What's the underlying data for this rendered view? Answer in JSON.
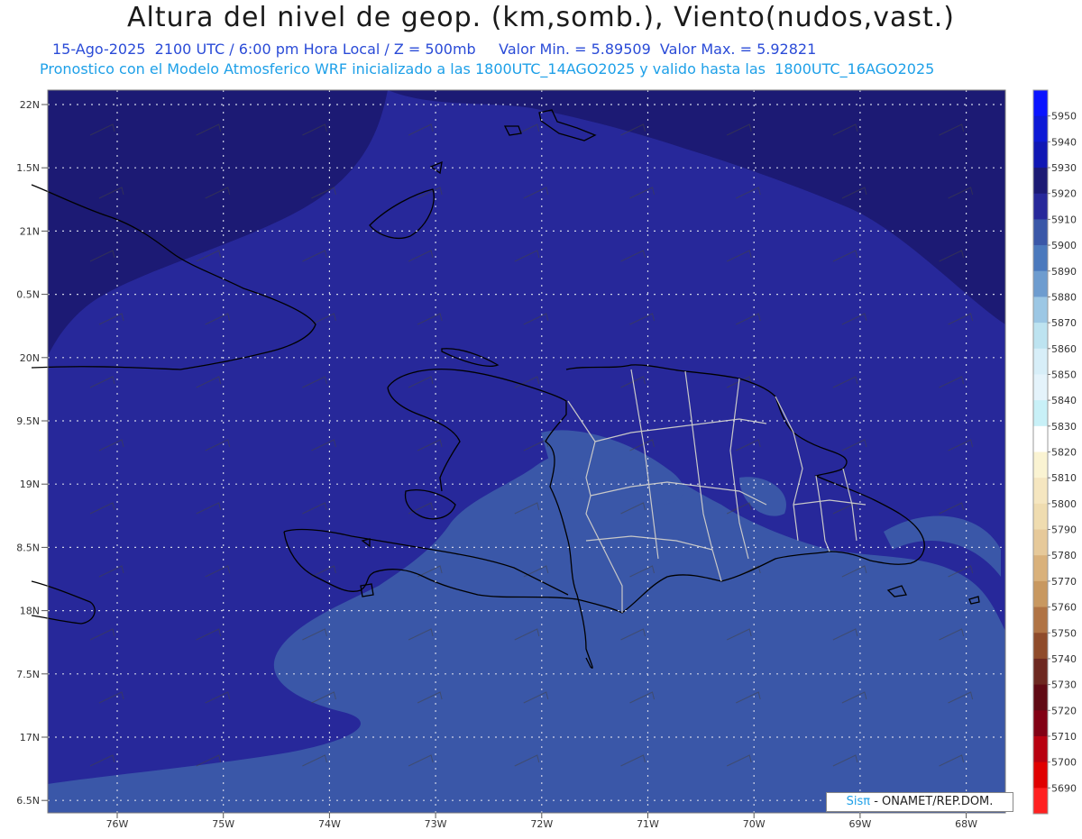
{
  "header": {
    "title": "Altura del nivel de geop. (km,somb.), Viento(nudos,vast.)",
    "subtitle1": "15-Ago-2025  2100 UTC / 6:00 pm Hora Local / Z = 500mb     Valor Min. = 5.89509  Valor Max. = 5.92821",
    "subtitle2": "Pronostico con el Modelo Atmosferico WRF inicializado a las 1800UTC_14AGO2025 y valido hasta las  1800UTC_16AGO2025"
  },
  "map": {
    "lat_labels": [
      "22N",
      "1.5N",
      "21N",
      "0.5N",
      "20N",
      "9.5N",
      "19N",
      "8.5N",
      "18N",
      "7.5N",
      "17N",
      "6.5N"
    ],
    "lon_labels": [
      "76W",
      "75W",
      "74W",
      "73W",
      "72W",
      "71W",
      "70W",
      "69W",
      "68W"
    ],
    "fill_colors": {
      "deep": "#1c1a74",
      "mid": "#27289a",
      "shallow": "#3a57a8"
    }
  },
  "colorbar": {
    "values": [
      "5950",
      "5940",
      "5930",
      "5920",
      "5910",
      "5900",
      "5890",
      "5880",
      "5870",
      "5860",
      "5850",
      "5840",
      "5830",
      "5820",
      "5810",
      "5800",
      "5790",
      "5780",
      "5770",
      "5760",
      "5750",
      "5740",
      "5730",
      "5720",
      "5710",
      "5700",
      "5690"
    ],
    "colors": [
      "#0a14ff",
      "#0d19d6",
      "#1017b4",
      "#1c1a74",
      "#27289a",
      "#3a57a8",
      "#4b79bd",
      "#6e9ccf",
      "#9cc7e4",
      "#bde3f0",
      "#d7eef8",
      "#e4f3fb",
      "#c8f0f7",
      "#ffffff",
      "#faf3d2",
      "#f5e6c0",
      "#efdcb0",
      "#e6c99a",
      "#d9b17b",
      "#c89860",
      "#b07344",
      "#8f4b2a",
      "#6d2820",
      "#600a14",
      "#820014",
      "#b80010",
      "#e00000",
      "#ff2020"
    ]
  },
  "credit": {
    "brand": "Sisπ",
    "text": " - ONAMET/REP.DOM."
  }
}
